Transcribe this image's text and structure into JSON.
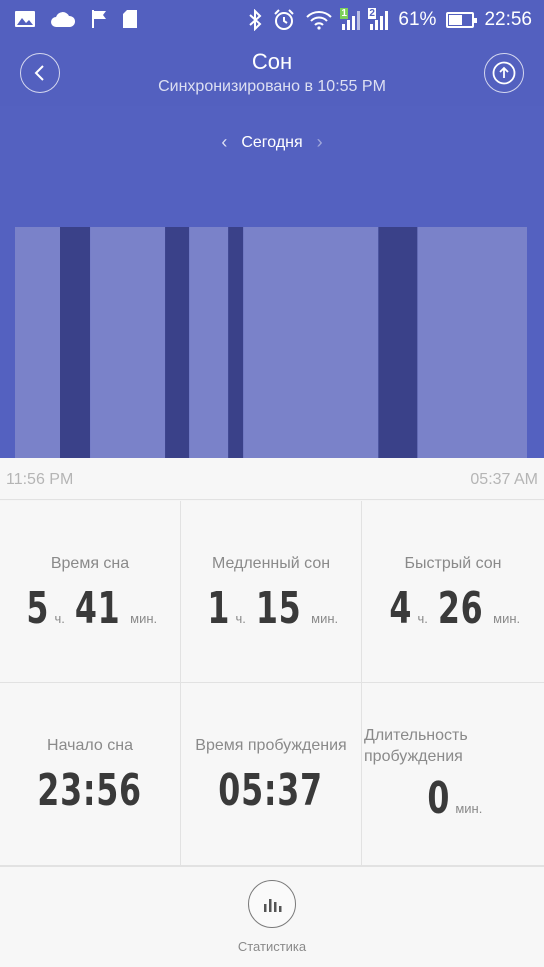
{
  "status_bar": {
    "battery_percent": "61%",
    "battery_level": 0.61,
    "time": "22:56",
    "sim1": "1",
    "sim2": "2",
    "icons": [
      "image-icon",
      "cloud-icon",
      "flag-icon",
      "sd-card-icon",
      "bluetooth-icon",
      "alarm-icon",
      "wifi-icon",
      "signal-icon",
      "battery-icon"
    ]
  },
  "header": {
    "title": "Сон",
    "subtitle": "Синхронизировано в 10:55 PM",
    "back_icon": "back-arrow-icon",
    "share_icon": "upload-icon"
  },
  "date_nav": {
    "label": "Сегодня",
    "prev_icon": "chevron-left-icon",
    "next_icon": "chevron-right-icon"
  },
  "chart_data": {
    "type": "bar",
    "title": "",
    "start_time": "11:56 PM",
    "end_time": "05:37 AM",
    "segments": [
      {
        "phase": "light",
        "start": "23:56",
        "end": "00:26"
      },
      {
        "phase": "deep",
        "start": "00:26",
        "end": "00:46"
      },
      {
        "phase": "light",
        "start": "00:46",
        "end": "01:36"
      },
      {
        "phase": "deep",
        "start": "01:36",
        "end": "01:52"
      },
      {
        "phase": "light",
        "start": "01:52",
        "end": "02:18"
      },
      {
        "phase": "deep",
        "start": "02:18",
        "end": "02:28"
      },
      {
        "phase": "light",
        "start": "02:28",
        "end": "03:58"
      },
      {
        "phase": "deep",
        "start": "03:58",
        "end": "04:24"
      },
      {
        "phase": "light",
        "start": "04:24",
        "end": "05:37"
      }
    ],
    "colors": {
      "light": "#7a82c9",
      "deep": "#3a4189",
      "background": "#5461c0"
    }
  },
  "time_axis": {
    "start": "11:56 PM",
    "end": "05:37 AM"
  },
  "stats": {
    "sleep_time": {
      "label": "Время сна",
      "hours": "5",
      "h_unit": "ч.",
      "minutes": "41",
      "m_unit": "мин."
    },
    "light_sleep": {
      "label": "Медленный сон",
      "hours": "1",
      "h_unit": "ч.",
      "minutes": "15",
      "m_unit": "мин."
    },
    "deep_sleep": {
      "label": "Быстрый сон",
      "hours": "4",
      "h_unit": "ч.",
      "minutes": "26",
      "m_unit": "мин."
    },
    "sleep_start": {
      "label": "Начало сна",
      "value": "23:56"
    },
    "wake_time": {
      "label": "Время пробуждения",
      "value": "05:37"
    },
    "awake_duration": {
      "label_line1": "Длительность",
      "label_line2": "пробуждения",
      "value": "0",
      "unit": "мин."
    }
  },
  "footer": {
    "stats_label": "Статистика",
    "stats_icon": "bar-chart-icon"
  }
}
